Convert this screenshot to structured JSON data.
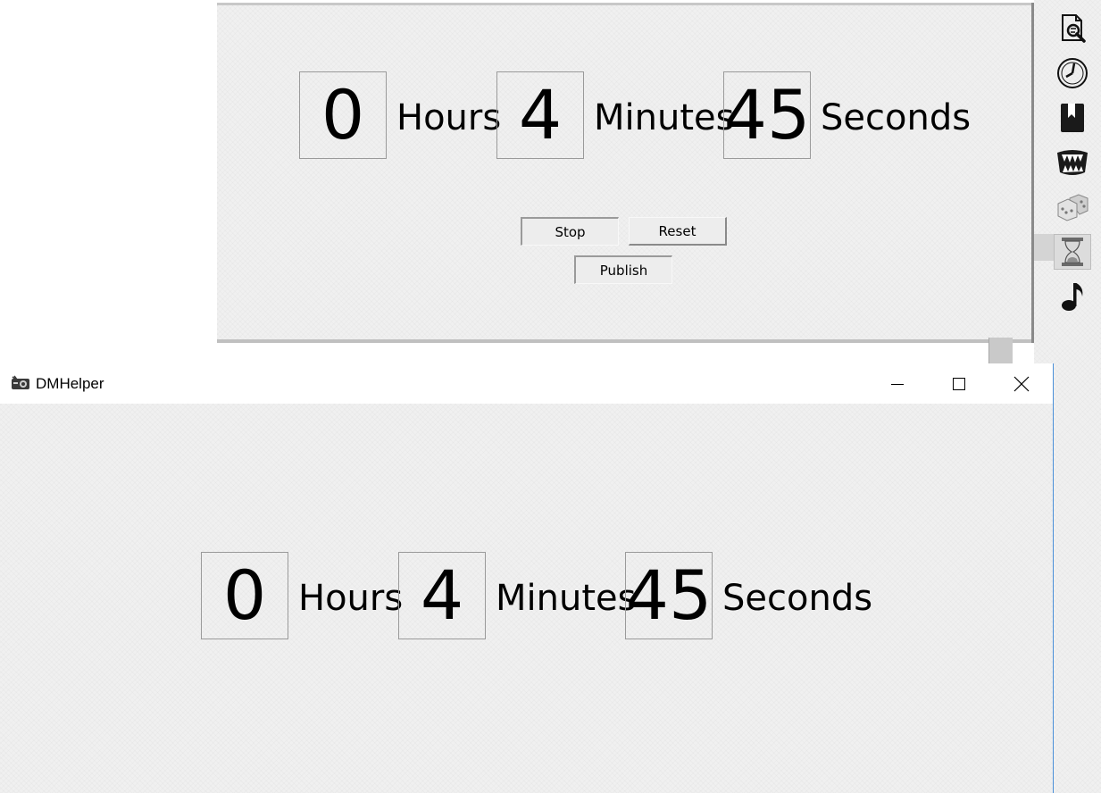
{
  "timer": {
    "hours": "0",
    "minutes": "4",
    "seconds": "45",
    "hours_label": "Hours",
    "minutes_label": "Minutes",
    "seconds_label": "Seconds"
  },
  "controls": {
    "stop_label": "Stop",
    "reset_label": "Reset",
    "publish_label": "Publish"
  },
  "toolbar": {
    "items": [
      {
        "icon": "search-document-icon"
      },
      {
        "icon": "clock-icon"
      },
      {
        "icon": "bookmark-book-icon"
      },
      {
        "icon": "monster-jaws-icon"
      },
      {
        "icon": "dice-icon"
      },
      {
        "icon": "hourglass-icon",
        "selected": true
      },
      {
        "icon": "music-note-icon"
      }
    ]
  },
  "player_window": {
    "title": "DMHelper",
    "timer": {
      "hours": "0",
      "minutes": "4",
      "seconds": "45",
      "hours_label": "Hours",
      "minutes_label": "Minutes",
      "seconds_label": "Seconds"
    }
  },
  "colors": {
    "background": "#f0f0f0",
    "window_border": "#4a90d9"
  }
}
